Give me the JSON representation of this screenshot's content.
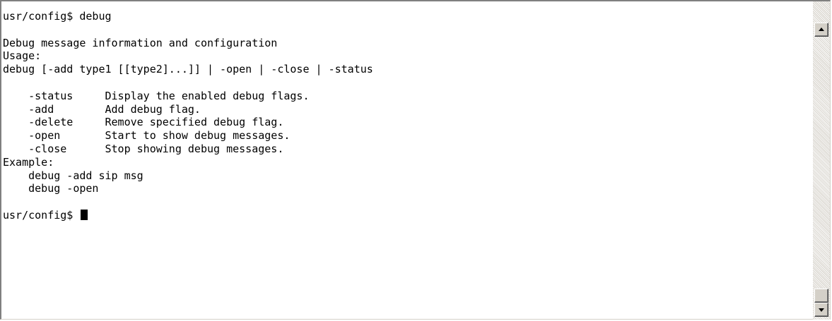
{
  "terminal": {
    "lines": [
      "usr/config$ debug",
      "",
      "Debug message information and configuration",
      "Usage:",
      "debug [-add type1 [[type2]...]] | -open | -close | -status",
      "",
      "    -status     Display the enabled debug flags.",
      "    -add        Add debug flag.",
      "    -delete     Remove specified debug flag.",
      "    -open       Start to show debug messages.",
      "    -close      Stop showing debug messages.",
      "Example:",
      "    debug -add sip msg",
      "    debug -open",
      ""
    ],
    "prompt": "usr/config$ "
  },
  "scrollbar": {
    "up_icon": "arrow-up-icon",
    "down_icon": "arrow-down-icon"
  }
}
